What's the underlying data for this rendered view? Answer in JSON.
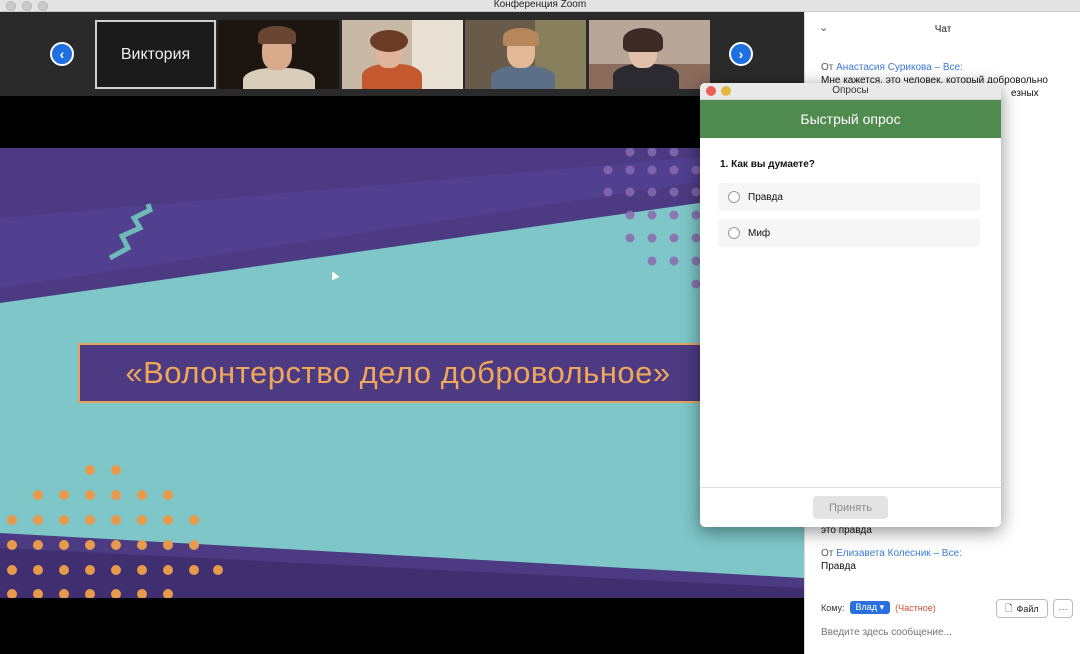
{
  "window": {
    "title": "Конференция Zoom"
  },
  "gallery": {
    "prev_label": "‹",
    "next_label": "›",
    "name_tile": "Виктория"
  },
  "slide": {
    "title": "«Волонтерство дело добровольное»"
  },
  "chat": {
    "title": "Чат",
    "messages": [
      {
        "from_prefix": "От",
        "sender": "Анастасия Сурикова – Все:",
        "text": "Мне кажется, это человек, который добровольно",
        "text2": "езных"
      },
      {
        "text": "это правда"
      },
      {
        "from_prefix": "От",
        "sender": "Елизавета Колесник – Все:",
        "text": "Правда"
      }
    ],
    "to_label": "Кому:",
    "to_recipient": "Влад",
    "to_private": "(Частное)",
    "file_label": "Файл",
    "more_label": "···",
    "input_placeholder": "Введите здесь сообщение..."
  },
  "poll": {
    "window_title": "Опросы",
    "header": "Быстрый опрос",
    "question": "1. Как вы думаете?",
    "options": [
      "Правда",
      "Миф"
    ],
    "submit_label": "Принять"
  },
  "colors": {
    "slide_purple": "#4c3a82",
    "slide_teal": "#7ec6c8",
    "slide_orange": "#e89a4c",
    "poll_green": "#4f8a4f",
    "accent_blue": "#2a70dd"
  }
}
